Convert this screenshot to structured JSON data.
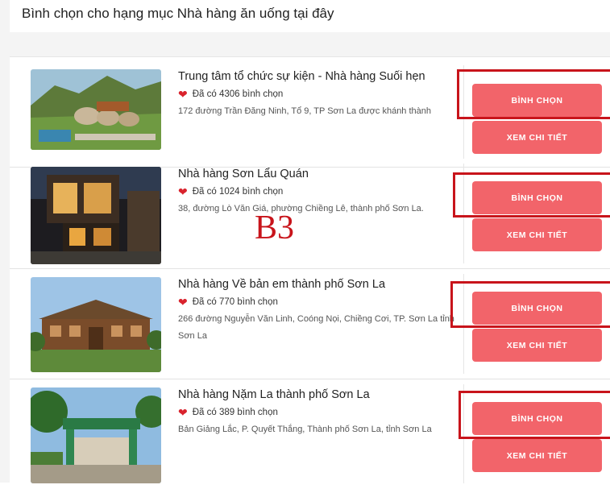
{
  "page": {
    "title": "Bình chọn cho hạng mục Nhà hàng ăn uống tại đây",
    "annotation": "B3"
  },
  "colors": {
    "button": "#f2646a",
    "heart": "#d9232d",
    "highlight_box": "#c8141b"
  },
  "restaurants": [
    {
      "name": "Trung tâm tổ chức sự kiện - Nhà hàng Suối hẹn",
      "votes_text": "Đã có 4306 bình chọn",
      "address": "172 đường Trần Đăng Ninh, Tổ 9, TP Sơn La được khánh thành",
      "vote_button": "BÌNH CHỌN",
      "detail_button": "XEM CHI TIẾT"
    },
    {
      "name": "Nhà hàng Sơn Lẩu Quán",
      "votes_text": "Đã có 1024 bình chọn",
      "address": "38, đường Lò Văn Giá, phường Chiềng Lê, thành phố Sơn La.",
      "vote_button": "BÌNH CHỌN",
      "detail_button": "XEM CHI TIẾT"
    },
    {
      "name": "Nhà hàng Về bản em thành phố Sơn La",
      "votes_text": "Đã có 770 bình chọn",
      "address": "266 đường Nguyễn Văn Linh, Coóng Nọi, Chiềng Cơi, TP. Sơn La tỉnh Sơn La",
      "vote_button": "BÌNH CHỌN",
      "detail_button": "XEM CHI TIẾT"
    },
    {
      "name": "Nhà hàng Nặm La thành phố Sơn La",
      "votes_text": "Đã có 389 bình chọn",
      "address": "Bản Giảng Lắc, P. Quyết Thắng, Thành phố Sơn La, tỉnh Sơn La",
      "vote_button": "BÌNH CHỌN",
      "detail_button": "XEM CHI TIẾT"
    }
  ]
}
